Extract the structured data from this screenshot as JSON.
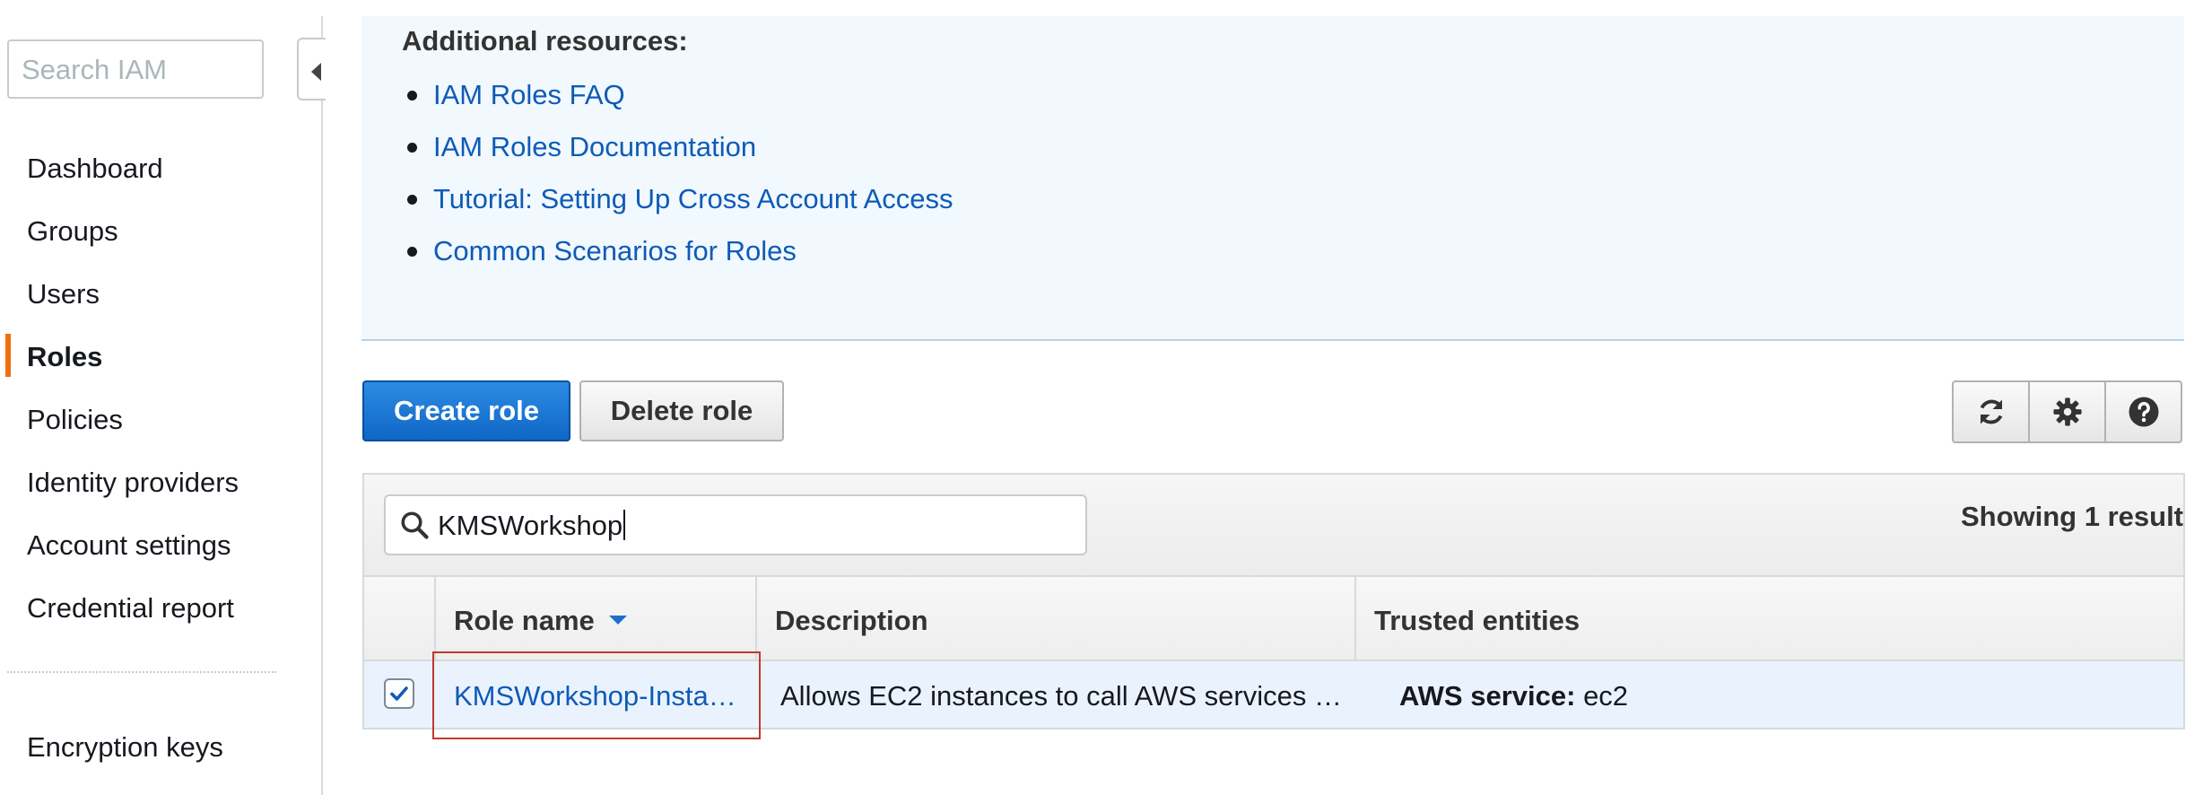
{
  "sidebar": {
    "search_placeholder": "Search IAM",
    "items": [
      {
        "label": "Dashboard"
      },
      {
        "label": "Groups"
      },
      {
        "label": "Users"
      },
      {
        "label": "Roles",
        "active": true
      },
      {
        "label": "Policies"
      },
      {
        "label": "Identity providers"
      },
      {
        "label": "Account settings"
      },
      {
        "label": "Credential report"
      },
      {
        "label": "Encryption keys"
      }
    ]
  },
  "resources": {
    "title": "Additional resources:",
    "links": [
      "IAM Roles FAQ",
      "IAM Roles Documentation",
      "Tutorial: Setting Up Cross Account Access",
      "Common Scenarios for Roles"
    ]
  },
  "toolbar": {
    "create_label": "Create role",
    "delete_label": "Delete role",
    "icons": [
      "refresh-icon",
      "gear-icon",
      "help-icon"
    ]
  },
  "table": {
    "filter_value": "KMSWorkshop",
    "result_text": "Showing 1 result",
    "columns": [
      "Role name",
      "Description",
      "Trusted entities"
    ],
    "rows": [
      {
        "checked": true,
        "role_name": "KMSWorkshop-Insta…",
        "description": "Allows EC2 instances to call AWS services …",
        "trusted_label": "AWS service:",
        "trusted_value": "ec2"
      }
    ]
  },
  "colors": {
    "accent": "#ec7211",
    "link": "#0e5bb7",
    "primary_button": "#1f73d3",
    "highlight_box": "#c0392b"
  }
}
